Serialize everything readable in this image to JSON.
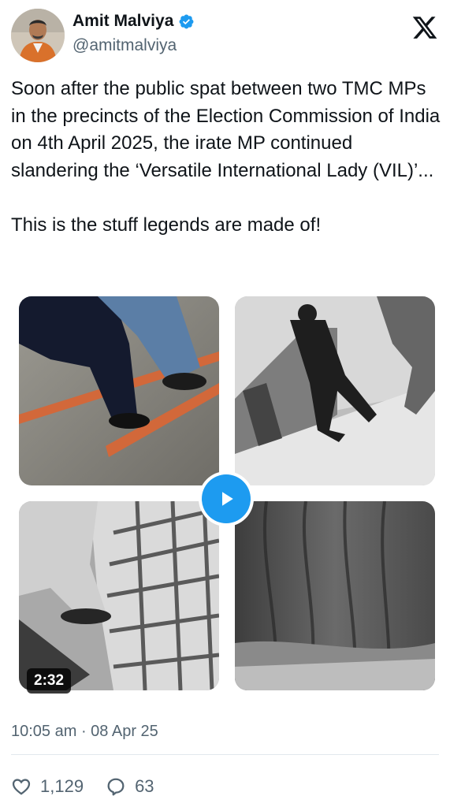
{
  "author": {
    "display_name": "Amit Malviya",
    "handle": "@amitmalviya",
    "verified": true,
    "avatar_icon": "profile-avatar"
  },
  "platform": {
    "logo_icon": "x-logo-icon"
  },
  "tweet": {
    "paragraphs": [
      "Soon after the public spat between two TMC MPs in the precincts of the Election Commission of India on 4th April 2025, the irate MP continued slandering the ‘Versatile International Lady (VIL)’...",
      "This is the stuff legends are made of!"
    ]
  },
  "media": {
    "duration": "2:32",
    "play_icon": "play-icon",
    "accent_color": "#1d9bf0"
  },
  "meta": {
    "timestamp": "10:05 am · 08 Apr 25"
  },
  "engagement": {
    "likes": "1,129",
    "replies": "63"
  }
}
